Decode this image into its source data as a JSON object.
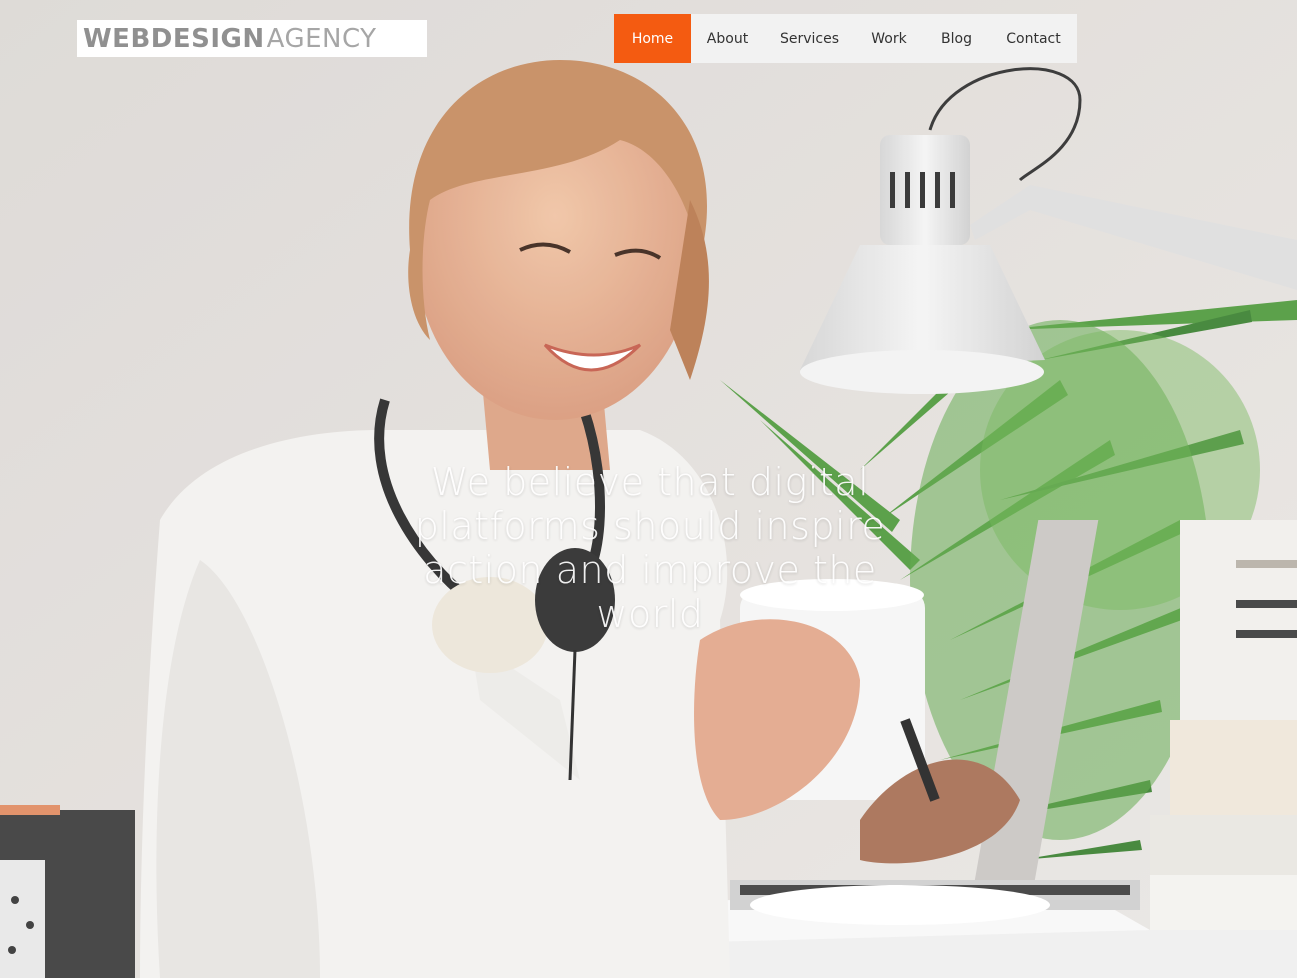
{
  "logo": {
    "part1": "WEBDESIGN",
    "part2": "AGENCY"
  },
  "nav": {
    "items": [
      {
        "label": "Home",
        "active": true
      },
      {
        "label": "About"
      },
      {
        "label": "Services"
      },
      {
        "label": "Work"
      },
      {
        "label": "Blog"
      },
      {
        "label": "Contact"
      }
    ]
  },
  "hero": {
    "headline": "We believe that digital platforms should inspire action and improve the world",
    "image": "woman-smiling-holding-coffee-mug-at-desk-with-lamp-plant-laptop-books"
  },
  "colors": {
    "accent": "#f45b11",
    "nav_bg": "#f2f2f2",
    "nav_text": "#333333",
    "logo_text": "#909090"
  }
}
